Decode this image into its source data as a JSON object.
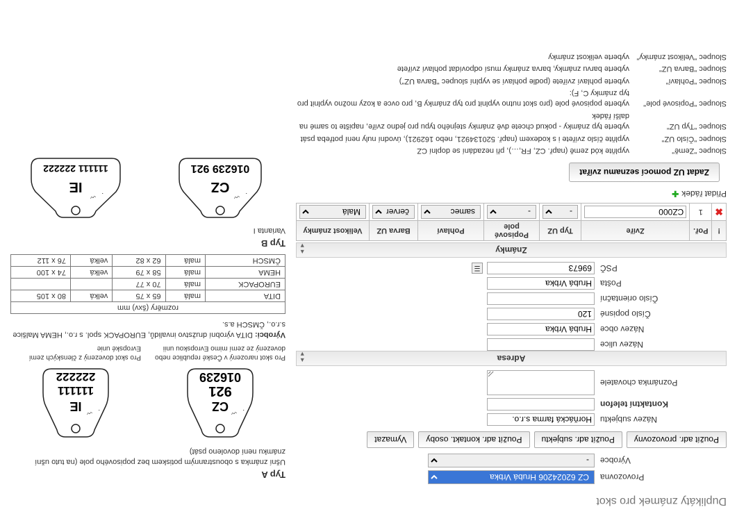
{
  "title": "Duplikáty známek pro skot",
  "form": {
    "provozovna": {
      "label": "Provozovna",
      "value": "CZ 62024206 Hrubá Vrbka"
    },
    "vyrobce": {
      "label": "Výrobce",
      "value": "-"
    },
    "buttons": {
      "adr_prov": "Použít adr. provozovny",
      "adr_subj": "Použít adr. subjektu",
      "adr_kont": "Použít adr. kontakt. osoby",
      "vymazat": "Vymazat"
    },
    "nazev_subjektu": {
      "label": "Název subjektu",
      "value": "Horňácká farma s.r.o."
    },
    "kontaktni_telefon": {
      "label": "Kontaktní telefon",
      "value": ""
    },
    "poznamka": {
      "label": "Poznámka chovatele",
      "value": ""
    }
  },
  "adresa": {
    "header": "Adresa",
    "nazev_ulice": {
      "label": "Název ulice",
      "value": ""
    },
    "nazev_obce": {
      "label": "Název obce",
      "value": "Hrubá Vrbka"
    },
    "cislo_popisne": {
      "label": "Číslo popisné",
      "value": "120"
    },
    "cislo_orientacni": {
      "label": "Číslo orientační",
      "value": ""
    },
    "posta": {
      "label": "Pošta",
      "value": "Hrubá Vrbka"
    },
    "psc": {
      "label": "PSČ",
      "value": "69673"
    }
  },
  "znamky": {
    "header": "Známky",
    "cols": {
      "del": "!",
      "por": "Poř.",
      "zvire": "Zvíře",
      "typ": "Typ UZ",
      "pole": "Popisové pole",
      "pohlavi": "Pohlaví",
      "barva": "Barva UZ",
      "velikost": "Velikost známky"
    },
    "row": {
      "por": "1",
      "zvire": "CZ000",
      "typ": "-",
      "pole": "-",
      "pohlavi": "samec",
      "barva": "červená",
      "velikost": "Malá"
    },
    "pridat": "Přidat řádek",
    "zadat_seznam": "Zadat UZ pomocí seznamu zvířat"
  },
  "help": {
    "zeme": {
      "k": "Sloupec \"Země\"",
      "v": "vyplňte kód země (např. CZ, FR,…), při nezadání se doplní CZ"
    },
    "cislo": {
      "k": "Sloupec \"Číslo UZ\"",
      "v": "vyplňte číslo zvířete i s kodexem (např. 520134921, nebo 162921), úvodní nuly není potřeba psát"
    },
    "typ": {
      "k": "Sloupec \"Typ UZ\"",
      "v": "vyberte typ známky - pokud chcete dvě známky stejného typu pro jedno zvíře, napište to samé na další řádek"
    },
    "pole": {
      "k": "Sloupec \"Popisové pole\"",
      "v": "vyberte popisové pole (pro skot nutno vyplnit pro typ známky B, pro ovce a kozy možno vyplnit pro typ známky C, F):"
    },
    "pohlavi": {
      "k": "Sloupec \"Pohlaví\"",
      "v": "vyberte pohlaví zvířete (podle pohlaví se vyplní sloupec \"Barva UZ\")"
    },
    "barva": {
      "k": "Sloupec \"Barva UZ\"",
      "v": "vyberte barvu známky, barva známky musí odpovídat pohlaví zvířete"
    },
    "velikost": {
      "k": "Sloupec \"Velikost známky\"",
      "v": "vyberte velikost známky"
    }
  },
  "right": {
    "typ_a": {
      "h": "Typ A",
      "p": "Ušní známka s oboustranným potiskem bez popisového pole (na tuto ušní známku není dovoleno psát)"
    },
    "tagA1": {
      "line1": "CZ",
      "line2": "921",
      "line3": "016239"
    },
    "tagA2": {
      "line1": "IE",
      "line2": "111111",
      "line3": "222222"
    },
    "capA1": "Pro skot narozený v České republice nebo dovezený ze zemí mimo Evropskou unii",
    "capA2": "Pro skot dovezený z členských zemí Evropské unie",
    "vyrobci": {
      "label": "Výrobci:",
      "text": "DITA výrobní družstvo invalidů, EUROPACK spol. s r.o., HEMA Malšice s.r.o., ČMSCH a.s."
    },
    "sizes": {
      "header": "rozměry (šxv) mm",
      "rows": [
        {
          "name": "DITA",
          "mala_l": "malá",
          "mala_v": "65 x 75",
          "velka_l": "velká",
          "velka_v": "80 x 105"
        },
        {
          "name": "EUROPACK",
          "mala_l": "malá",
          "mala_v": "70 x 77",
          "velka_l": "",
          "velka_v": ""
        },
        {
          "name": "HEMA",
          "mala_l": "malá",
          "mala_v": "58 x 79",
          "velka_l": "velká",
          "velka_v": "74 x 100"
        },
        {
          "name": "ČMSCH",
          "mala_l": "malá",
          "mala_v": "62 x 82",
          "velka_l": "velká",
          "velka_v": "76 x 112"
        }
      ]
    },
    "typ_b": {
      "h": "Typ B",
      "var": "Varianta I"
    },
    "tagB1": {
      "line1": "CZ",
      "line2": "016239 921"
    },
    "tagB2": {
      "line1": "IE",
      "line2": "111111 222222"
    }
  }
}
